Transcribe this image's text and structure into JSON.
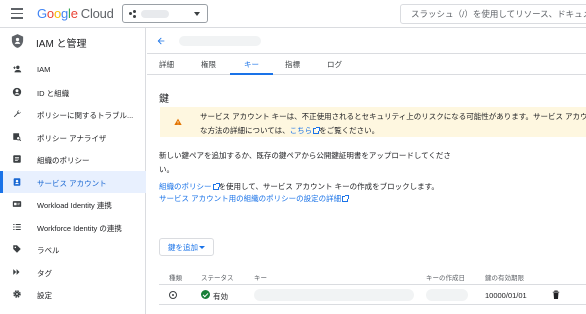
{
  "header": {
    "logo_text": "Google",
    "logo_suffix": "Cloud",
    "search_placeholder": "スラッシュ（/）を使用してリソース、ドキュメ"
  },
  "sidebar": {
    "title": "IAM と管理",
    "items": [
      {
        "label": "IAM",
        "icon": "person-add-icon"
      },
      {
        "label": "ID と組織",
        "icon": "account-circle-icon"
      },
      {
        "label": "ポリシーに関するトラブル...",
        "icon": "wrench-icon"
      },
      {
        "label": "ポリシー アナライザ",
        "icon": "policy-search-icon"
      },
      {
        "label": "組織のポリシー",
        "icon": "list-box-icon"
      },
      {
        "label": "サービス アカウント",
        "icon": "service-account-icon",
        "active": true
      },
      {
        "label": "Workload Identity 連携",
        "icon": "id-card-icon"
      },
      {
        "label": "Workforce Identity の連携",
        "icon": "list-icon"
      },
      {
        "label": "ラベル",
        "icon": "label-icon"
      },
      {
        "label": "タグ",
        "icon": "tag-icon"
      },
      {
        "label": "設定",
        "icon": "gear-icon"
      }
    ]
  },
  "tabs": [
    "詳細",
    "権限",
    "キー",
    "指標",
    "ログ"
  ],
  "active_tab": "キー",
  "main": {
    "section_title": "鍵",
    "warning_line1": "サービス アカウント キーは、不正使用されるとセキュリティ上のリスクになる可能性があります。サービス アカウン",
    "warning_line2_pre": "な方法の詳細については、",
    "warning_link": "こちら",
    "warning_line2_post": "をご覧ください。",
    "description": "新しい鍵ペアを追加するか、既存の鍵ペアから公開鍵証明書をアップロードしてください。",
    "policy_link": "組織のポリシー",
    "policy_text": "を使用して、サービス アカウント キーの作成をブロックします。",
    "policy_detail_link": "サービス アカウント用の組織のポリシーの設定の詳細",
    "add_key_label": "鍵を追加"
  },
  "table": {
    "columns": [
      "種類",
      "ステータス",
      "キー",
      "キーの作成日",
      "鍵の有効期限"
    ],
    "rows": [
      {
        "status": "有効",
        "expiry": "10000/01/01"
      }
    ]
  },
  "colors": {
    "accent": "#1a73e8",
    "warning_bg": "#fef7e0",
    "active_bg": "#e8f0fe",
    "status_ok": "#188038"
  }
}
